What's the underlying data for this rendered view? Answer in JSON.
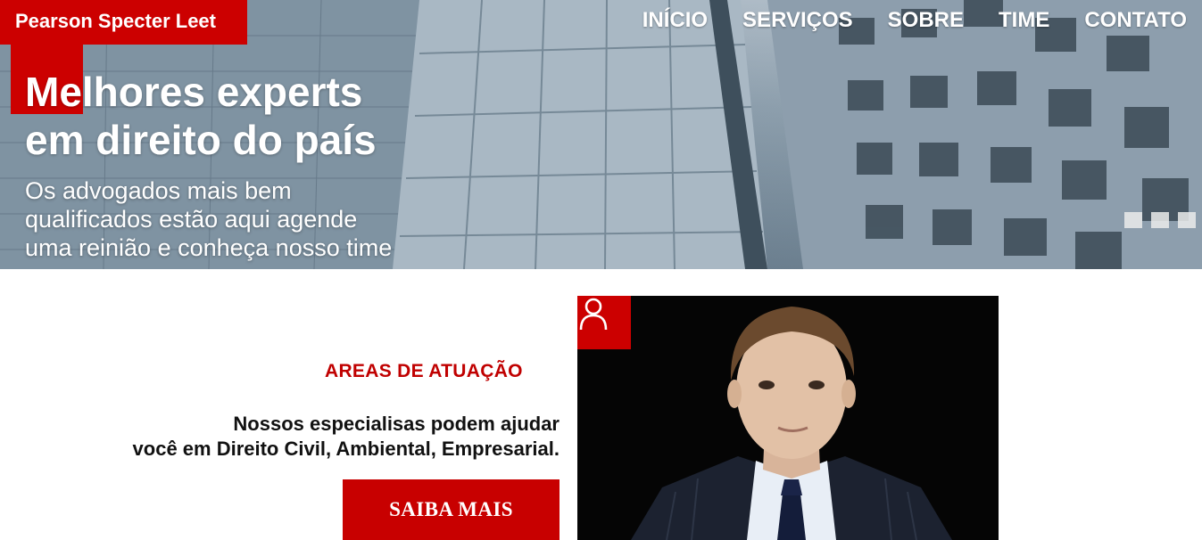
{
  "brand": {
    "name": "Pearson Specter Leet"
  },
  "nav": {
    "items": [
      "INÍCIO",
      "SERVIÇOS",
      "SOBRE",
      "TIME",
      "CONTATO"
    ]
  },
  "hero": {
    "title_line1": "Melhores experts",
    "title_line2": "em direito do país",
    "subtitle_line1": "Os advogados mais bem",
    "subtitle_line2": "qualificados estão aqui agende",
    "subtitle_line3": "uma reinião e conheça nosso time",
    "slide_count": 3
  },
  "areas": {
    "title": "AREAS DE ATUAÇÃO",
    "text_line1": "Nossos especialisas podem ajudar",
    "text_line2": "você em Direito Civil, Ambiental, Empresarial.",
    "button": "SAIBA MAIS"
  },
  "icons": {
    "user_badge": "user-icon"
  },
  "colors": {
    "accent": "#cc0000",
    "text": "#111111",
    "background": "#ffffff"
  }
}
